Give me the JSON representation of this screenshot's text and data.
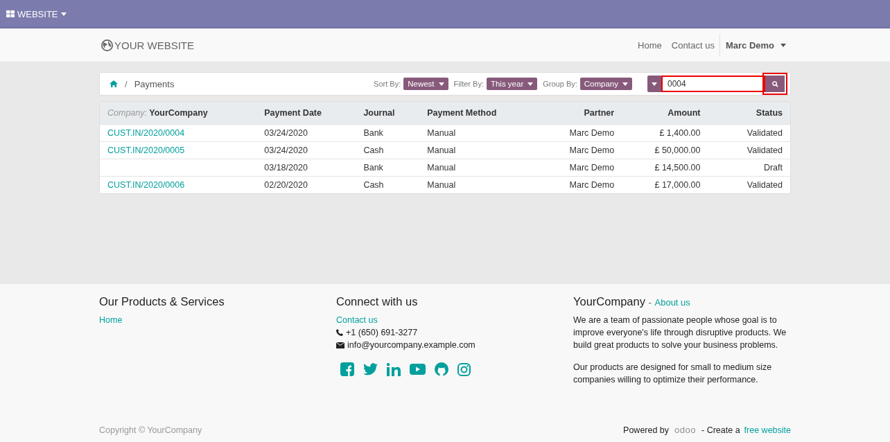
{
  "topbar": {
    "app_menu": "WEBSITE"
  },
  "header": {
    "logo": "YOUR WEBSITE",
    "nav": [
      "Home",
      "Contact us"
    ],
    "user": "Marc Demo"
  },
  "breadcrumb": {
    "separator": "/",
    "current": "Payments"
  },
  "controls": [
    {
      "label": "Sort By:",
      "value": "Newest"
    },
    {
      "label": "Filter By:",
      "value": "This year"
    },
    {
      "label": "Group By:",
      "value": "Company"
    }
  ],
  "search": {
    "value": "0004",
    "highlighted": true,
    "button_highlighted": true
  },
  "table": {
    "group_label": "Company:",
    "group_value": "YourCompany",
    "columns": [
      "Payment Date",
      "Journal",
      "Payment Method",
      "Partner",
      "Amount",
      "Status"
    ],
    "rows": [
      {
        "number": "CUST.IN/2020/0004",
        "cells": [
          "03/24/2020",
          "Bank",
          "Manual",
          "Marc Demo",
          "£ 1,400.00",
          "Validated"
        ]
      },
      {
        "number": "CUST.IN/2020/0005",
        "cells": [
          "03/24/2020",
          "Cash",
          "Manual",
          "Marc Demo",
          "£ 50,000.00",
          "Validated"
        ]
      },
      {
        "cells": [
          "03/18/2020",
          "Bank",
          "Manual",
          "Marc Demo",
          "£ 14,500.00",
          "Draft"
        ]
      },
      {
        "number": "CUST.IN/2020/0006",
        "cells": [
          "02/20/2020",
          "Cash",
          "Manual",
          "Marc Demo",
          "£ 17,000.00",
          "Validated"
        ]
      }
    ]
  },
  "footer": {
    "products": {
      "title": "Our Products & Services",
      "links": [
        "Home"
      ]
    },
    "connect": {
      "title": "Connect with us",
      "link": "Contact us",
      "phone": "+1 (650) 691-3277",
      "email": "info@yourcompany.example.com",
      "social": [
        {
          "kind": "facebook"
        },
        {
          "kind": "twitter"
        },
        {
          "kind": "linkedin"
        },
        {
          "kind": "youtube"
        },
        {
          "kind": "github"
        },
        {
          "kind": "instagram"
        }
      ]
    },
    "about": {
      "title": "YourCompany",
      "separator": "-",
      "link": "About us",
      "paragraphs": [
        "We are a team of passionate people whose goal is to improve everyone's life through disruptive products. We build great products to solve your business problems.",
        "Our products are designed for small to medium size companies willing to optimize their performance."
      ]
    },
    "copyright": "Copyright © YourCompany",
    "powered": {
      "prefix": "Powered by",
      "logo": "odoo",
      "middle": "- Create a",
      "link": "free website"
    }
  }
}
